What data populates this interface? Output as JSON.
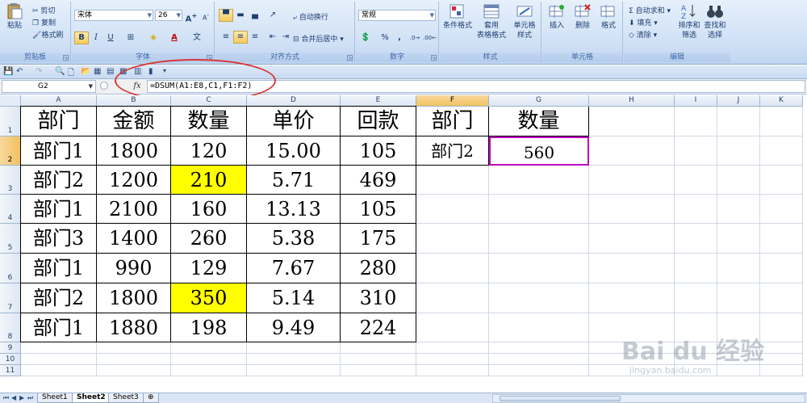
{
  "ribbon": {
    "clipboard": {
      "paste": "粘贴",
      "cut": "剪切",
      "copy": "复制",
      "format_painter": "格式刷",
      "label": "剪贴板"
    },
    "font": {
      "name": "宋体",
      "size": "26",
      "label": "字体",
      "bold": "B",
      "italic": "I",
      "underline": "U"
    },
    "alignment": {
      "wrap": "自动换行",
      "merge": "合并后居中",
      "label": "对齐方式"
    },
    "number": {
      "format": "常规",
      "percent": "%",
      "comma": ",",
      "label": "数字"
    },
    "styles": {
      "conditional": "条件格式",
      "table_format": "套用\n表格格式",
      "cell_style": "单元格\n样式",
      "label": "样式"
    },
    "cells": {
      "insert": "插入",
      "delete": "删除",
      "format": "格式",
      "label": "单元格"
    },
    "editing": {
      "autosum": "自动求和",
      "fill": "填充",
      "clear": "清除",
      "sort": "排序和\n筛选",
      "find": "查找和\n选择",
      "label": "编辑"
    }
  },
  "formula_bar": {
    "name_box": "G2",
    "fx": "fx",
    "formula": "=DSUM(A1:E8,C1,F1:F2)"
  },
  "grid": {
    "columns": [
      "A",
      "B",
      "C",
      "D",
      "E",
      "F",
      "G",
      "H",
      "I",
      "J",
      "K"
    ],
    "rows": [
      "1",
      "2",
      "3",
      "4",
      "5",
      "6",
      "7",
      "8",
      "9",
      "10",
      "11"
    ],
    "headers": [
      "部门",
      "金额",
      "数量",
      "单价",
      "回款"
    ],
    "data": [
      [
        "部门1",
        "1800",
        "120",
        "15.00",
        "105"
      ],
      [
        "部门2",
        "1200",
        "210",
        "5.71",
        "469"
      ],
      [
        "部门1",
        "2100",
        "160",
        "13.13",
        "105"
      ],
      [
        "部门3",
        "1400",
        "260",
        "5.38",
        "175"
      ],
      [
        "部门1",
        "990",
        "129",
        "7.67",
        "280"
      ],
      [
        "部门2",
        "1800",
        "350",
        "5.14",
        "310"
      ],
      [
        "部门1",
        "1880",
        "198",
        "9.49",
        "224"
      ]
    ],
    "criteria_header": "部门",
    "criteria_value": "部门2",
    "result_header": "数量",
    "result_value": "560",
    "highlight_color": "#ffff00",
    "active_border_color": "#c000c0"
  },
  "sheets": [
    "Sheet1",
    "Sheet2",
    "Sheet3"
  ],
  "active_sheet": "Sheet2",
  "watermark": {
    "brand": "Bai du 经验",
    "url": "jingyan.baidu.com"
  }
}
